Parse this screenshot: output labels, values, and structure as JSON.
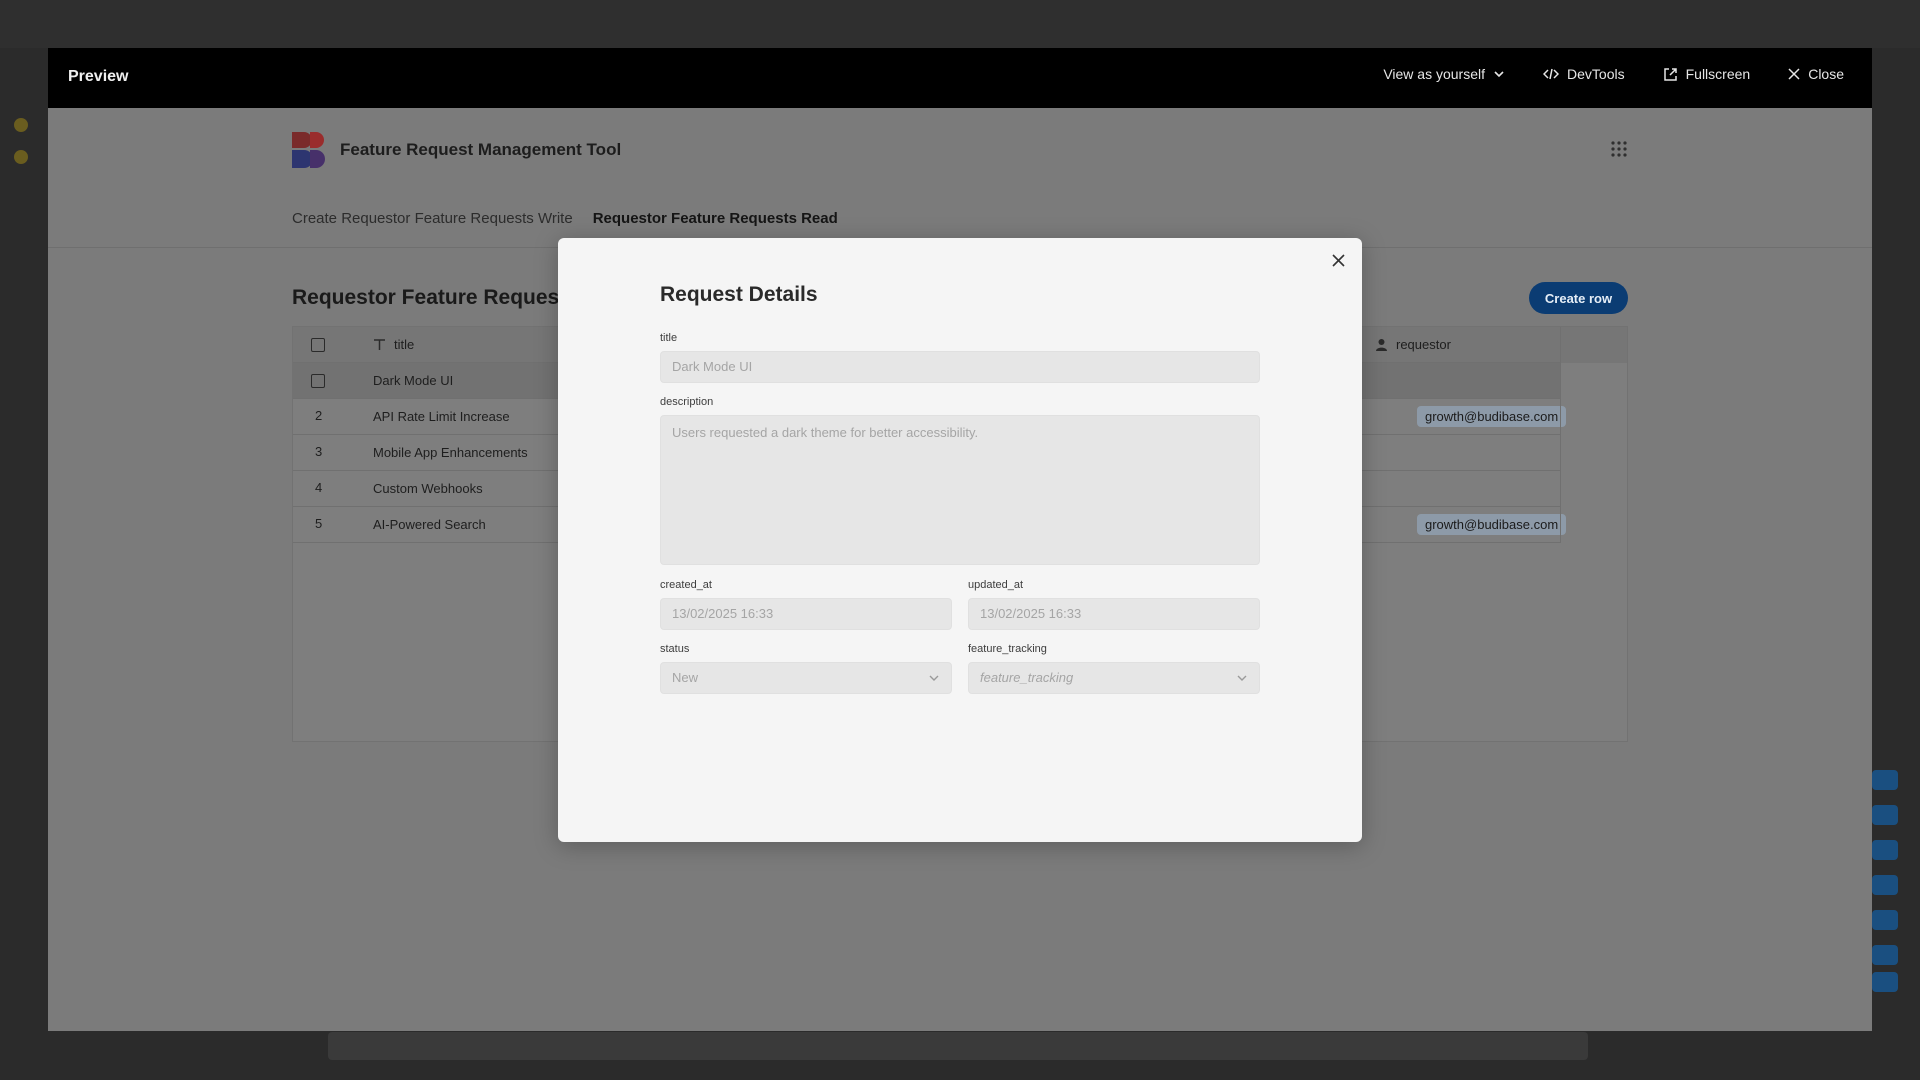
{
  "preview": {
    "title": "Preview",
    "actions": {
      "view_as": "View as yourself",
      "devtools": "DevTools",
      "fullscreen": "Fullscreen",
      "close": "Close"
    }
  },
  "app": {
    "name": "Feature Request Management Tool",
    "nav": [
      {
        "label": "Create Requestor Feature Requests Write"
      },
      {
        "label": "Requestor Feature Requests Read"
      }
    ],
    "table": {
      "title": "Requestor Feature Requests",
      "create_button": "Create row",
      "columns": {
        "title": "title",
        "requestor": "requestor"
      },
      "rows": [
        {
          "num": "",
          "title": "Dark Mode UI",
          "requestor": ""
        },
        {
          "num": "2",
          "title": "API Rate Limit Increase",
          "requestor": "growth@budibase.com"
        },
        {
          "num": "3",
          "title": "Mobile App Enhancements",
          "requestor": ""
        },
        {
          "num": "4",
          "title": "Custom Webhooks",
          "requestor": ""
        },
        {
          "num": "5",
          "title": "AI-Powered Search",
          "requestor": "growth@budibase.com"
        }
      ]
    }
  },
  "modal": {
    "title": "Request Details",
    "fields": {
      "title": {
        "label": "title",
        "value": "Dark Mode UI"
      },
      "description": {
        "label": "description",
        "value": "Users requested a dark theme for better accessibility."
      },
      "created_at": {
        "label": "created_at",
        "value": "13/02/2025 16:33"
      },
      "updated_at": {
        "label": "updated_at",
        "value": "13/02/2025 16:33"
      },
      "status": {
        "label": "status",
        "value": "New"
      },
      "feature_tracking": {
        "label": "feature_tracking",
        "placeholder": "feature_tracking"
      }
    }
  },
  "colors": {
    "accent": "#0b3c73",
    "preview_header": "#000000",
    "modal_bg": "#f5f5f5"
  }
}
